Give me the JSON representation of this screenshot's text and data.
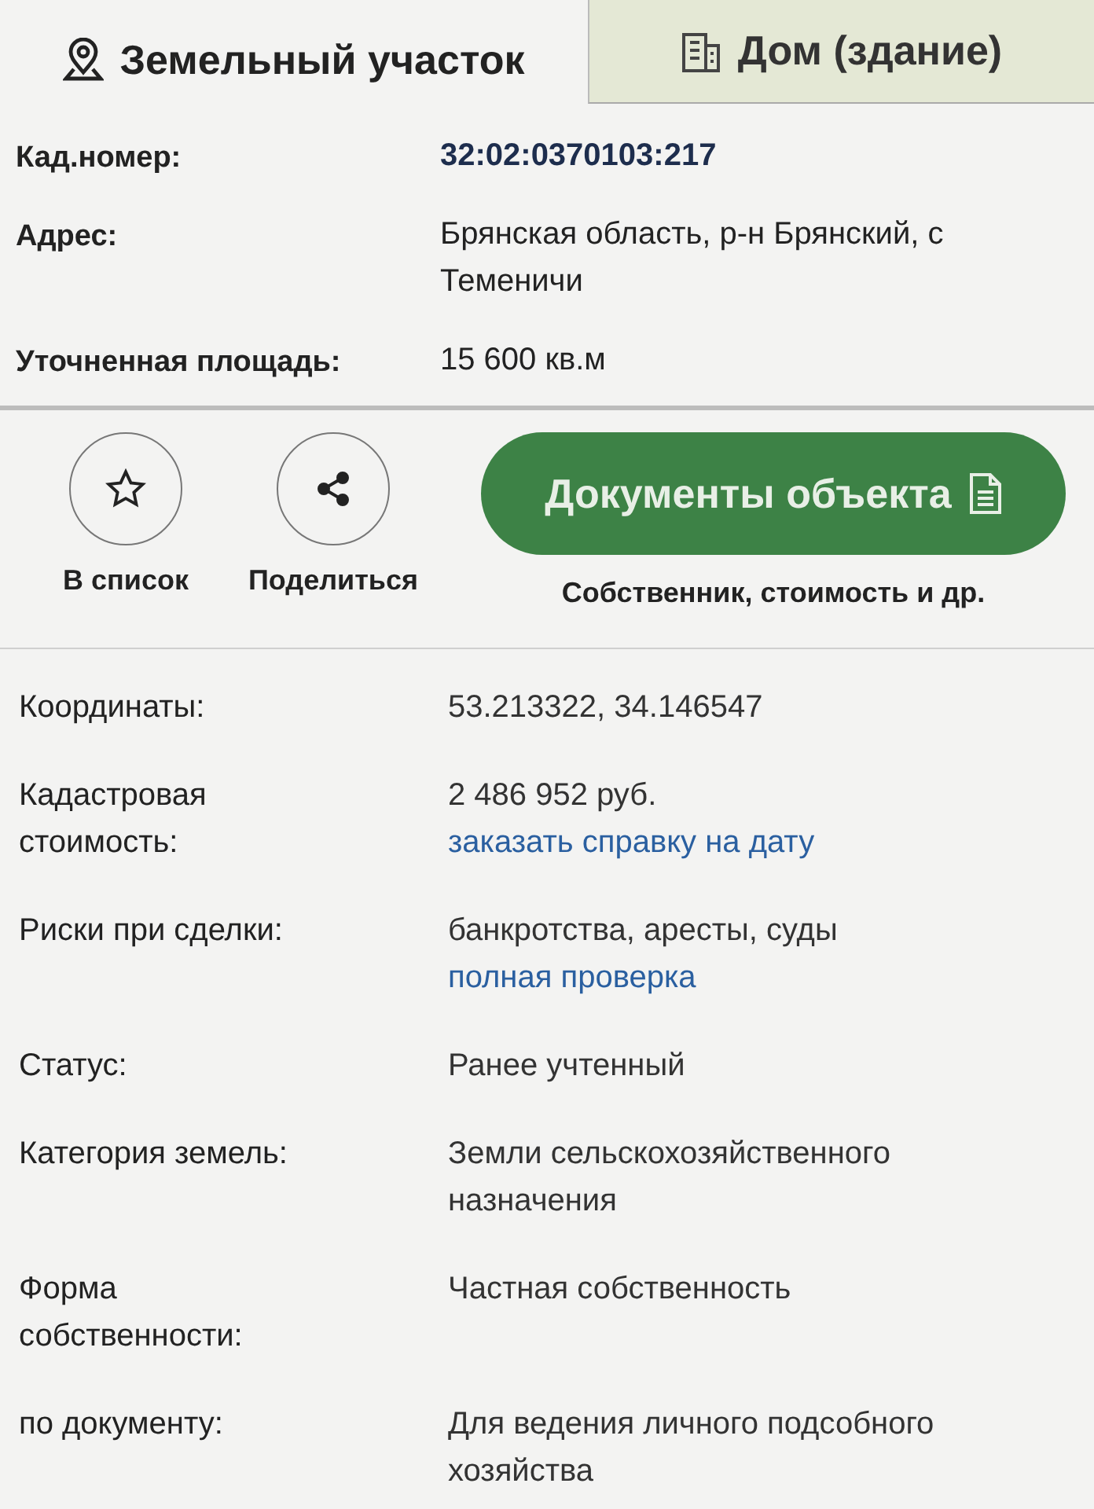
{
  "tabs": [
    {
      "label": "Земельный участок",
      "kind": "pin",
      "selected": true
    },
    {
      "label": "Дом (здание)",
      "kind": "building",
      "selected": false
    }
  ],
  "summary": [
    {
      "label": "Кад.номер:",
      "value": "32:02:0370103:217",
      "kind": "id"
    },
    {
      "label": "Адрес:",
      "value": "Брянская область, р-н Брянский, с Теменичи",
      "kind": "text"
    },
    {
      "label": "Уточненная площадь:",
      "value": "15 600 кв.м",
      "kind": "text"
    }
  ],
  "actions": [
    {
      "label": "В список",
      "kind": "star"
    },
    {
      "label": "Поделиться",
      "kind": "share"
    }
  ],
  "documents": {
    "label": "Документы объекта",
    "caption": "Собственник, стоимость и др."
  },
  "details": [
    {
      "label": "Координаты:",
      "value": "53.213322, 34.146547"
    },
    {
      "label": "Кадастровая стоимость:",
      "value": "2 486 952 руб.",
      "link": "заказать справку на дату"
    },
    {
      "label": "Риски при сделки:",
      "value": "банкротства, аресты, суды",
      "link": "полная проверка"
    },
    {
      "label": "Статус:",
      "value": "Ранее учтенный"
    },
    {
      "label": "Категория земель:",
      "value": "Земли сельскохозяйственного назначения"
    },
    {
      "label": "Форма собственности:",
      "value": "Частная собственность"
    },
    {
      "label": "по документу:",
      "value": "Для ведения личного подсобного хозяйства"
    }
  ]
}
